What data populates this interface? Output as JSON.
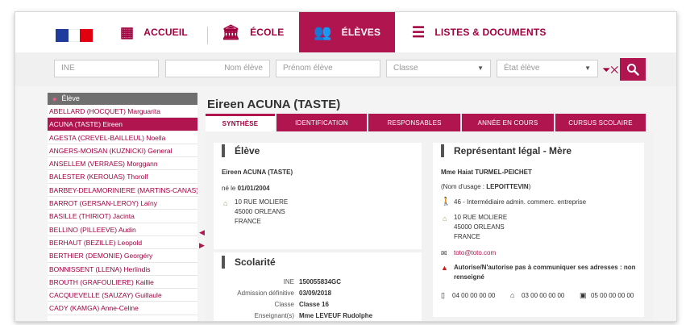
{
  "nav": {
    "items": [
      {
        "label": "ACCUEIL",
        "icon": "grid-icon"
      },
      {
        "label": "ÉCOLE",
        "icon": "school-building-icon"
      },
      {
        "label": "ÉLÈVES",
        "icon": "students-icon"
      },
      {
        "label": "LISTES & DOCUMENTS",
        "icon": "list-icon"
      }
    ],
    "active": "ÉLÈVES"
  },
  "search": {
    "ine_placeholder": "INE",
    "nom_placeholder": "Nom élève",
    "prenom_placeholder": "Prénom élève",
    "classe_placeholder": "Classe",
    "etat_placeholder": "État élève"
  },
  "list": {
    "header": "Élève",
    "items": [
      "ABELLARD (HOCQUET) Marguarita",
      "ACUNA (TASTE) Eireen",
      "AGESTA (CREVEL-BAILLEUL) Noella",
      "ANGERS-MOISAN (KUZNICKI) General",
      "ANSELLEM (VERRAES) Morggann",
      "BALESTER (KEROUAS) Thorolf",
      "BARBEY-DELAMORINIERE (MARTINS-CANAS) J",
      "BARROT (GERSAN-LEROY) Laïny",
      "BASILLE (THIRIOT) Jacinta",
      "BELLINO (PILLEEVE) Audin",
      "BERHAUT (BEZILLE) Leopold",
      "BERTHIER (DEMONIE) Georgéry",
      "BONNISSENT (LLENA) Herlindis",
      "BROUTH (GRAFOULIERE) Kaillie",
      "CACQUEVELLE (SAUZAY) Guillaule",
      "CADY (KAMGA) Anne-Celine"
    ],
    "selected_index": 1
  },
  "student": {
    "title": "Eireen ACUNA (TASTE)"
  },
  "tabs": [
    "SYNTHÈSE",
    "IDENTIFICATION",
    "RESPONSABLES",
    "ANNÉE EN COURS",
    "CURSUS SCOLAIRE"
  ],
  "eleve_card": {
    "heading": "Élève",
    "name": "Eireen ACUNA (TASTE)",
    "born_prefix": "né le",
    "born_date": "01/01/2004",
    "address_1": "10 RUE MOLIERE",
    "address_2": "45000 ORLEANS",
    "address_3": "FRANCE"
  },
  "scolarite_card": {
    "heading": "Scolarité",
    "rows": [
      {
        "label": "INE",
        "value": "150055834GC"
      },
      {
        "label": "Admission définitive",
        "value": "03/09/2018"
      },
      {
        "label": "Classe",
        "value": "Classe 16"
      },
      {
        "label": "Enseignant(s)",
        "value": "Mme LEVEUF Rudolphe"
      }
    ]
  },
  "rep_card": {
    "heading": "Représentant légal - Mère",
    "name": "Mme Haiat TURMEL-PEICHET",
    "usage_prefix": "(Nom d'usage :",
    "usage_name": "LEPOITTEVIN",
    "usage_suffix": ")",
    "profession": "46 - Intermédiaire admin. commerc. entreprise",
    "address_1": "10 RUE MOLIERE",
    "address_2": "45000 ORLEANS",
    "address_3": "FRANCE",
    "email": "toto@toto.com",
    "warning": "Autorise/N'autorise pas à communiquer ses adresses : non renseigné",
    "phone_mobile": "04 00 00 00 00",
    "phone_home": "03 00 00 00 00",
    "phone_work": "05 00 00 00 00"
  },
  "colors": {
    "accent": "#b0154f",
    "text_accent": "#a1003f",
    "flag_blue": "#1f3b9c",
    "flag_red": "#e1000f"
  }
}
